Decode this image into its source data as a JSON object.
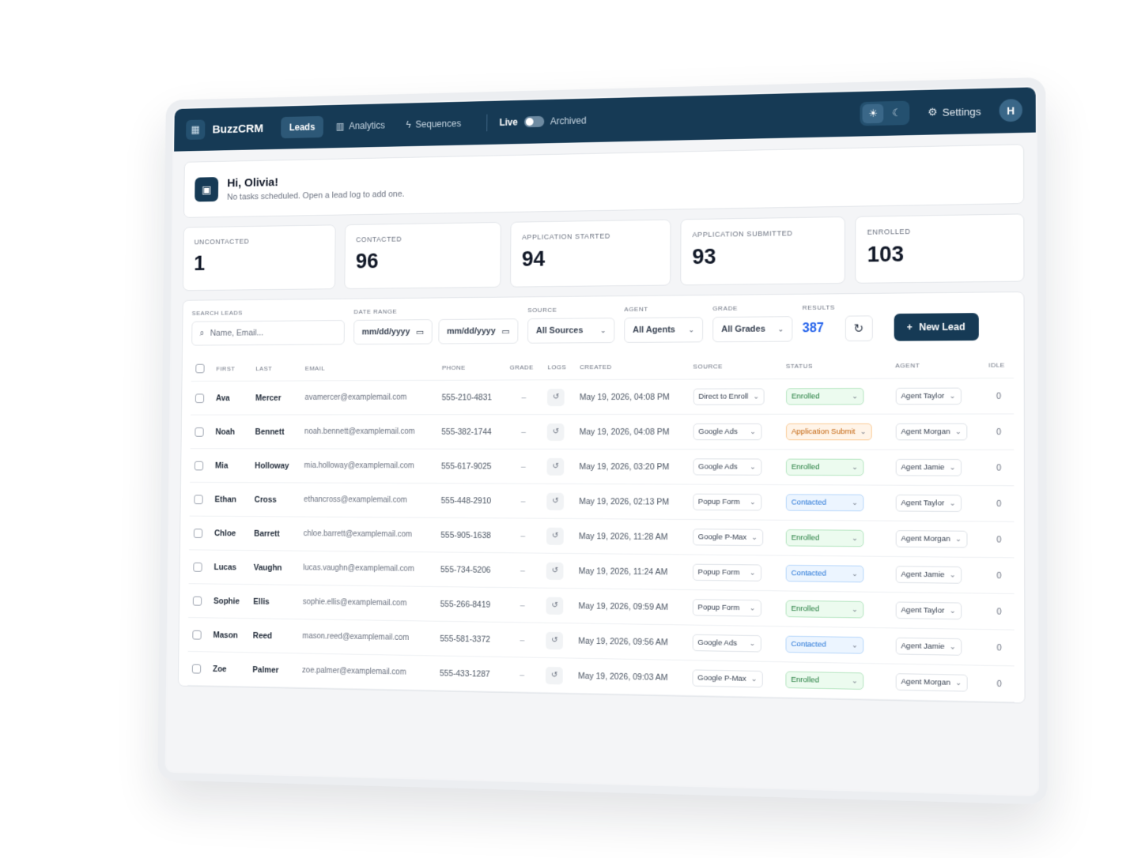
{
  "nav": {
    "brand": "BuzzCRM",
    "items": [
      {
        "label": "Leads",
        "icon": "grid-icon"
      },
      {
        "label": "Analytics",
        "icon": "bar-chart-icon"
      },
      {
        "label": "Sequences",
        "icon": "bolt-icon"
      }
    ],
    "live_label": "Live",
    "archived_label": "Archived",
    "settings_label": "Settings",
    "avatar_initial": "H"
  },
  "greeting": {
    "title": "Hi, Olivia!",
    "subtitle": "No tasks scheduled. Open a lead log to add one."
  },
  "stats": [
    {
      "label": "Uncontacted",
      "value": "1"
    },
    {
      "label": "Contacted",
      "value": "96"
    },
    {
      "label": "Application Started",
      "value": "94"
    },
    {
      "label": "Application Submitted",
      "value": "93"
    },
    {
      "label": "Enrolled",
      "value": "103"
    }
  ],
  "filters": {
    "search_label": "Search Leads",
    "search_placeholder": "Name, Email...",
    "date_label": "Date Range",
    "date_from": "mm/dd/yyyy",
    "date_to": "mm/dd/yyyy",
    "source_label": "Source",
    "source_value": "All Sources",
    "agent_label": "Agent",
    "agent_value": "All Agents",
    "grade_label": "Grade",
    "grade_value": "All Grades",
    "results_label": "Results",
    "results_value": "387",
    "new_lead_label": "New Lead"
  },
  "table": {
    "headers": [
      "First",
      "Last",
      "Email",
      "Phone",
      "Grade",
      "Logs",
      "Created",
      "Source",
      "Status",
      "Agent",
      "Idle"
    ],
    "rows": [
      {
        "first": "Ava",
        "last": "Mercer",
        "email": "avamercer@examplemail.com",
        "phone": "555-210-4831",
        "grade": "–",
        "created": "May 19, 2026, 04:08 PM",
        "source": "Direct to Enroll",
        "status": "Enrolled",
        "status_type": "enrolled",
        "agent": "Agent Taylor",
        "idle": "0"
      },
      {
        "first": "Noah",
        "last": "Bennett",
        "email": "noah.bennett@examplemail.com",
        "phone": "555-382-1744",
        "grade": "–",
        "created": "May 19, 2026, 04:08 PM",
        "source": "Google Ads",
        "status": "Application Submit",
        "status_type": "submit",
        "agent": "Agent Morgan",
        "idle": "0"
      },
      {
        "first": "Mia",
        "last": "Holloway",
        "email": "mia.holloway@examplemail.com",
        "phone": "555-617-9025",
        "grade": "–",
        "created": "May 19, 2026, 03:20 PM",
        "source": "Google Ads",
        "status": "Enrolled",
        "status_type": "enrolled",
        "agent": "Agent Jamie",
        "idle": "0"
      },
      {
        "first": "Ethan",
        "last": "Cross",
        "email": "ethancross@examplemail.com",
        "phone": "555-448-2910",
        "grade": "–",
        "created": "May 19, 2026, 02:13 PM",
        "source": "Popup Form",
        "status": "Contacted",
        "status_type": "contacted",
        "agent": "Agent Taylor",
        "idle": "0"
      },
      {
        "first": "Chloe",
        "last": "Barrett",
        "email": "chloe.barrett@examplemail.com",
        "phone": "555-905-1638",
        "grade": "–",
        "created": "May 19, 2026, 11:28 AM",
        "source": "Google P-Max",
        "status": "Enrolled",
        "status_type": "enrolled",
        "agent": "Agent Morgan",
        "idle": "0"
      },
      {
        "first": "Lucas",
        "last": "Vaughn",
        "email": "lucas.vaughn@examplemail.com",
        "phone": "555-734-5206",
        "grade": "–",
        "created": "May 19, 2026, 11:24 AM",
        "source": "Popup Form",
        "status": "Contacted",
        "status_type": "contacted",
        "agent": "Agent Jamie",
        "idle": "0"
      },
      {
        "first": "Sophie",
        "last": "Ellis",
        "email": "sophie.ellis@examplemail.com",
        "phone": "555-266-8419",
        "grade": "–",
        "created": "May 19, 2026, 09:59 AM",
        "source": "Popup Form",
        "status": "Enrolled",
        "status_type": "enrolled",
        "agent": "Agent Taylor",
        "idle": "0"
      },
      {
        "first": "Mason",
        "last": "Reed",
        "email": "mason.reed@examplemail.com",
        "phone": "555-581-3372",
        "grade": "–",
        "created": "May 19, 2026, 09:56 AM",
        "source": "Google Ads",
        "status": "Contacted",
        "status_type": "contacted",
        "agent": "Agent Jamie",
        "idle": "0"
      },
      {
        "first": "Zoe",
        "last": "Palmer",
        "email": "zoe.palmer@examplemail.com",
        "phone": "555-433-1287",
        "grade": "–",
        "created": "May 19, 2026, 09:03 AM",
        "source": "Google P-Max",
        "status": "Enrolled",
        "status_type": "enrolled",
        "agent": "Agent Morgan",
        "idle": "0"
      }
    ]
  },
  "colors": {
    "nav_bg": "#163a55",
    "accent_blue": "#2563eb",
    "enrolled": "#1f7a3a",
    "submit": "#c2620a",
    "contacted": "#2474d6"
  }
}
